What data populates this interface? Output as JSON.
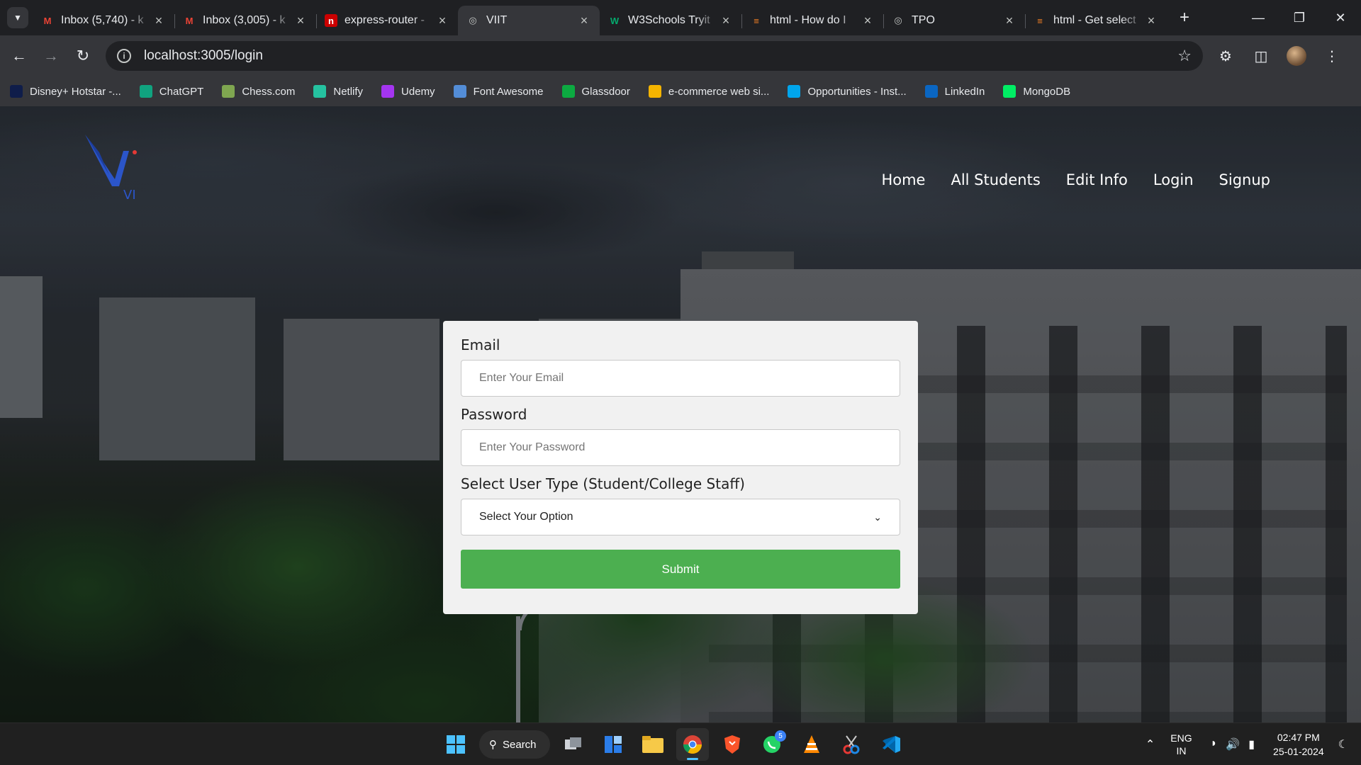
{
  "browser": {
    "tabs": [
      {
        "title": "Inbox (5,740) - k",
        "icon": "gmail-icon",
        "active": false
      },
      {
        "title": "Inbox (3,005) - k",
        "icon": "gmail-icon",
        "active": false
      },
      {
        "title": "express-router -",
        "icon": "npm-icon",
        "active": false
      },
      {
        "title": "VIIT",
        "icon": "globe-icon",
        "active": true
      },
      {
        "title": "W3Schools Tryit",
        "icon": "w3schools-icon",
        "active": false
      },
      {
        "title": "html - How do I",
        "icon": "stackoverflow-icon",
        "active": false
      },
      {
        "title": "TPO",
        "icon": "globe-icon",
        "active": false
      },
      {
        "title": "html - Get select",
        "icon": "stackoverflow-icon",
        "active": false
      }
    ],
    "url": "localhost:3005/login",
    "bookmarks": [
      {
        "label": "Disney+ Hotstar -...",
        "icon": "hotstar-icon",
        "color": "#0f1d4a"
      },
      {
        "label": "ChatGPT",
        "icon": "chatgpt-icon",
        "color": "#10a37f"
      },
      {
        "label": "Chess.com",
        "icon": "chess-icon",
        "color": "#7fa650"
      },
      {
        "label": "Netlify",
        "icon": "netlify-icon",
        "color": "#25c2a0"
      },
      {
        "label": "Udemy",
        "icon": "udemy-icon",
        "color": "#a435f0"
      },
      {
        "label": "Font Awesome",
        "icon": "font-awesome-icon",
        "color": "#538dd7"
      },
      {
        "label": "Glassdoor",
        "icon": "glassdoor-icon",
        "color": "#0caa41"
      },
      {
        "label": "e-commerce web si...",
        "icon": "ecommerce-icon",
        "color": "#f4b400"
      },
      {
        "label": "Opportunities - Inst...",
        "icon": "internshala-icon",
        "color": "#00a5ec"
      },
      {
        "label": "LinkedIn",
        "icon": "linkedin-icon",
        "color": "#0a66c2"
      },
      {
        "label": "MongoDB",
        "icon": "mongodb-icon",
        "color": "#00ed64"
      }
    ]
  },
  "site": {
    "logo_text": "VI",
    "nav": [
      "Home",
      "All Students",
      "Edit Info",
      "Login",
      "Signup"
    ]
  },
  "form": {
    "email_label": "Email",
    "email_placeholder": "Enter Your Email",
    "password_label": "Password",
    "password_placeholder": "Enter Your Password",
    "usertype_label": "Select User Type (Student/College Staff)",
    "usertype_selected": "Select Your Option",
    "submit_label": "Submit",
    "submit_color": "#4caf50"
  },
  "taskbar": {
    "search_label": "Search",
    "whatsapp_badge": "5",
    "language": "ENG",
    "region": "IN",
    "time": "02:47 PM",
    "date": "25-01-2024"
  }
}
